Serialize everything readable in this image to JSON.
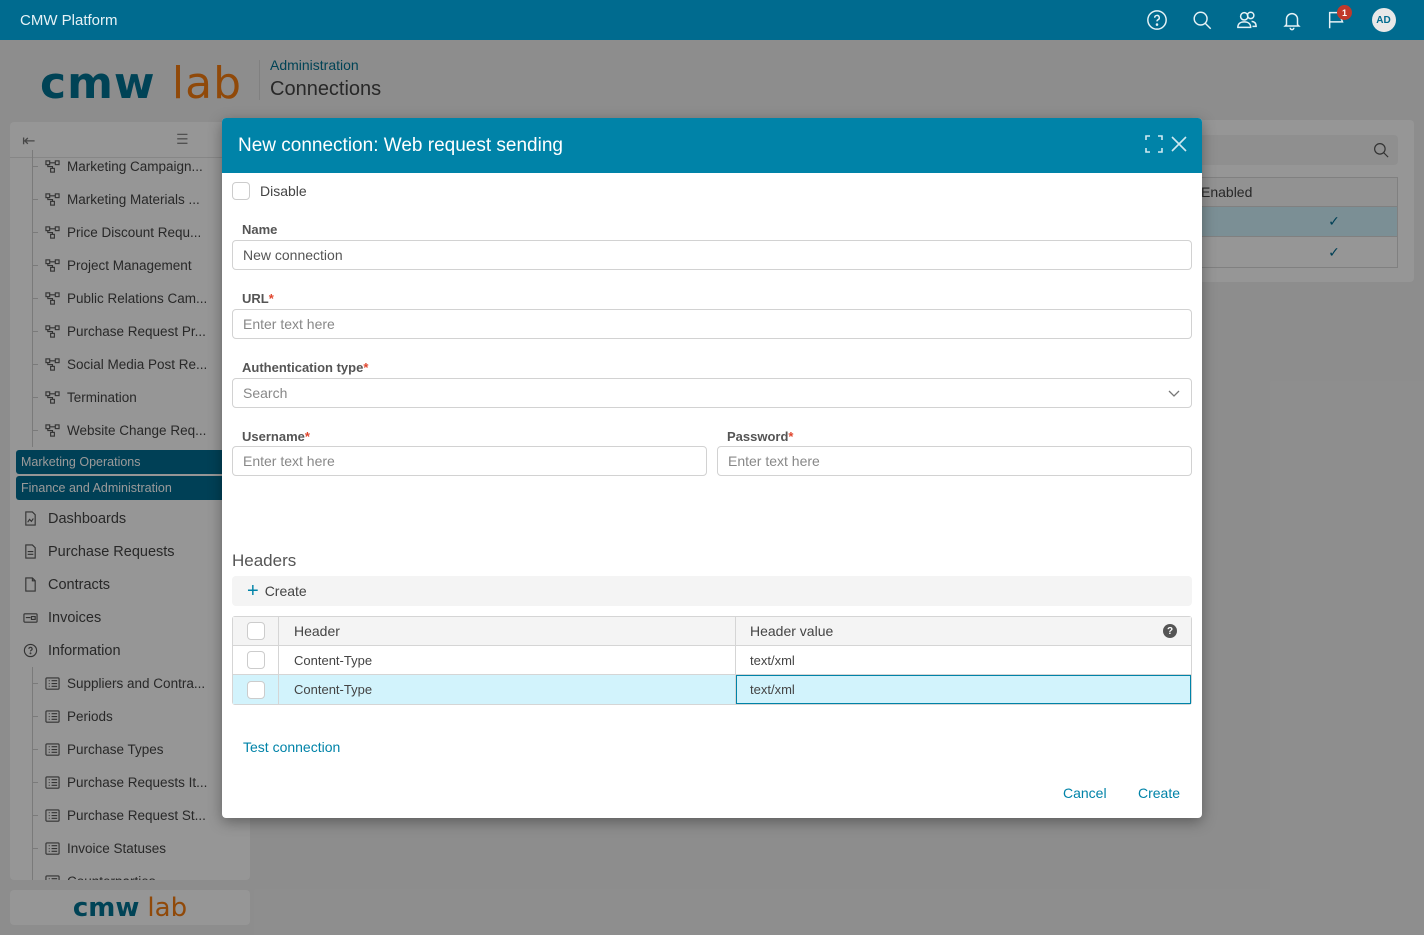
{
  "topbar": {
    "app_title": "CMW Platform",
    "icons": [
      "help-icon",
      "search-icon",
      "users-icon",
      "bell-icon",
      "flag-icon"
    ],
    "notification_count": "1",
    "avatar_initials": "AD"
  },
  "header": {
    "logo_part1": "cmw",
    "logo_part2": "lab",
    "breadcrumb": "Administration",
    "title": "Connections"
  },
  "sidebar": {
    "process_items": [
      {
        "label": "Marketing Campaign..."
      },
      {
        "label": "Marketing Materials ..."
      },
      {
        "label": "Price Discount Requ..."
      },
      {
        "label": "Project Management"
      },
      {
        "label": "Public Relations Cam..."
      },
      {
        "label": "Purchase Request Pr..."
      },
      {
        "label": "Social Media Post Re..."
      },
      {
        "label": "Termination"
      },
      {
        "label": "Website Change Req..."
      }
    ],
    "groups": [
      {
        "label": "Marketing Operations"
      },
      {
        "label": "Finance and Administration"
      }
    ],
    "top_items": [
      {
        "label": "Dashboards",
        "icon": "dashboard-icon"
      },
      {
        "label": "Purchase Requests",
        "icon": "document-icon"
      },
      {
        "label": "Contracts",
        "icon": "file-icon"
      },
      {
        "label": "Invoices",
        "icon": "invoice-icon"
      },
      {
        "label": "Information",
        "icon": "help-circle-icon"
      }
    ],
    "info_items": [
      {
        "label": "Suppliers and Contra..."
      },
      {
        "label": "Periods"
      },
      {
        "label": "Purchase Types"
      },
      {
        "label": "Purchase Requests It..."
      },
      {
        "label": "Purchase Request St..."
      },
      {
        "label": "Invoice Statuses"
      },
      {
        "label": "Counterparties"
      }
    ],
    "footer_logo_part1": "cmw",
    "footer_logo_part2": "lab"
  },
  "right_panel": {
    "column_header": "Enabled",
    "rows": [
      {
        "enabled": "✓",
        "selected": true
      },
      {
        "enabled": "✓",
        "selected": false
      }
    ]
  },
  "dialog": {
    "title": "New connection: Web request sending",
    "disable_label": "Disable",
    "disable_checked": false,
    "name_label": "Name",
    "name_value": "New connection",
    "url_label": "URL",
    "url_placeholder": "Enter text here",
    "auth_label": "Authentication type",
    "auth_placeholder": "Search",
    "username_label": "Username",
    "username_placeholder": "Enter text here",
    "password_label": "Password",
    "password_placeholder": "Enter text here",
    "required_mark": "*",
    "headers_title": "Headers",
    "create_header_label": "Create",
    "headers_table": {
      "columns": [
        "Header",
        "Header value"
      ],
      "rows": [
        {
          "header": "Content-Type",
          "value": "text/xml",
          "selected": false
        },
        {
          "header": "Content-Type",
          "value": "text/xml",
          "selected": true
        }
      ]
    },
    "test_connection_label": "Test connection",
    "cancel_label": "Cancel",
    "create_label": "Create"
  }
}
